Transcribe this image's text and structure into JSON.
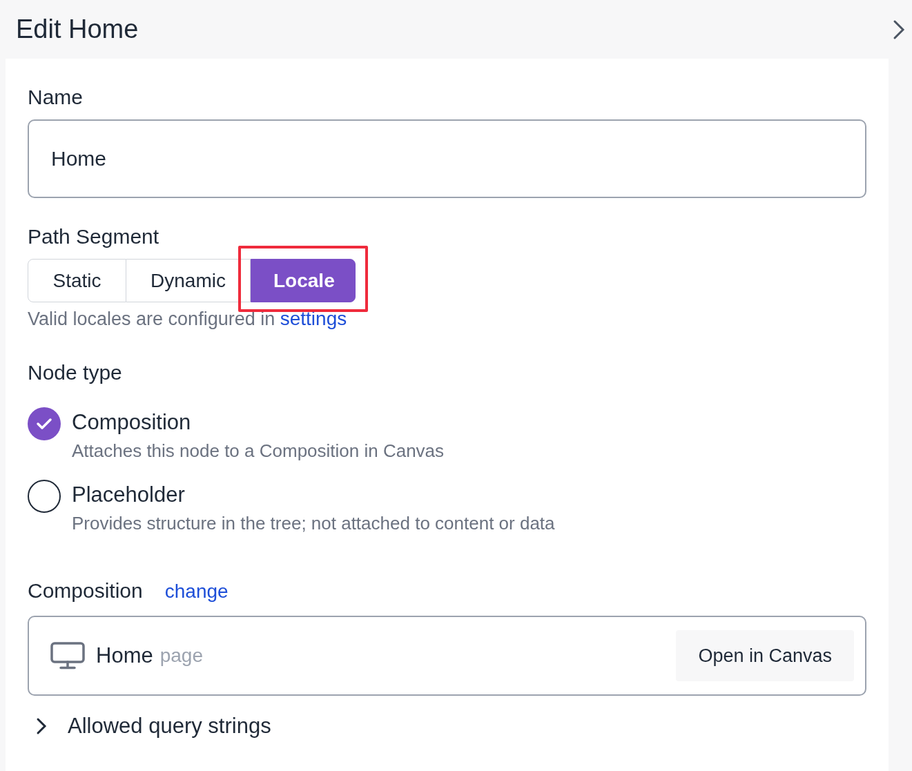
{
  "header": {
    "title": "Edit Home"
  },
  "name_field": {
    "label": "Name",
    "value": "Home"
  },
  "path_segment": {
    "label": "Path Segment",
    "options": [
      {
        "label": "Static",
        "selected": false,
        "highlighted": false
      },
      {
        "label": "Dynamic",
        "selected": false,
        "highlighted": false
      },
      {
        "label": "Locale",
        "selected": true,
        "highlighted": true
      }
    ],
    "hint": "Valid locales are configured in",
    "hint_link": "settings"
  },
  "node_type": {
    "label": "Node type",
    "options": [
      {
        "title": "Composition",
        "description": "Attaches this node to a Composition in Canvas",
        "selected": true
      },
      {
        "title": "Placeholder",
        "description": "Provides structure in the tree; not attached to content or data",
        "selected": false
      }
    ]
  },
  "composition": {
    "label": "Composition",
    "change_link": "change",
    "name": "Home",
    "type": "page",
    "open_button": "Open in Canvas"
  },
  "allowed_query_strings": {
    "label": "Allowed query strings",
    "expanded": false
  }
}
